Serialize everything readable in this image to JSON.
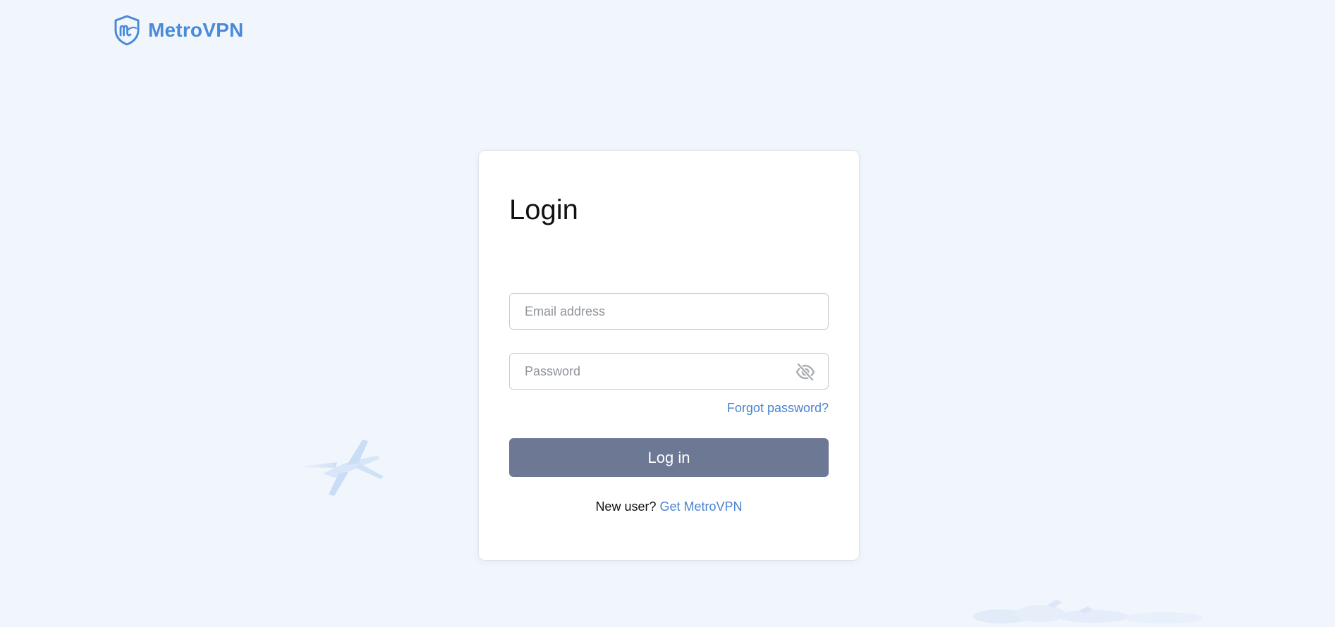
{
  "brand": {
    "name": "MetroVPN",
    "logo_icon": "metrovpn-shield-logo",
    "color": "#4a8ad6"
  },
  "login": {
    "title": "Login",
    "email_placeholder": "Email address",
    "password_placeholder": "Password",
    "password_visibility_icon": "eye-off-icon",
    "forgot_password": "Forgot password?",
    "submit_label": "Log in",
    "signup_prompt": "New user?",
    "signup_link": "Get MetroVPN"
  },
  "colors": {
    "background": "#f1f6fd",
    "accent": "#4a83cf",
    "button": "#6d7895"
  },
  "decor": {
    "plane_icon": "airplane-icon",
    "clouds_icon": "clouds-icon"
  }
}
